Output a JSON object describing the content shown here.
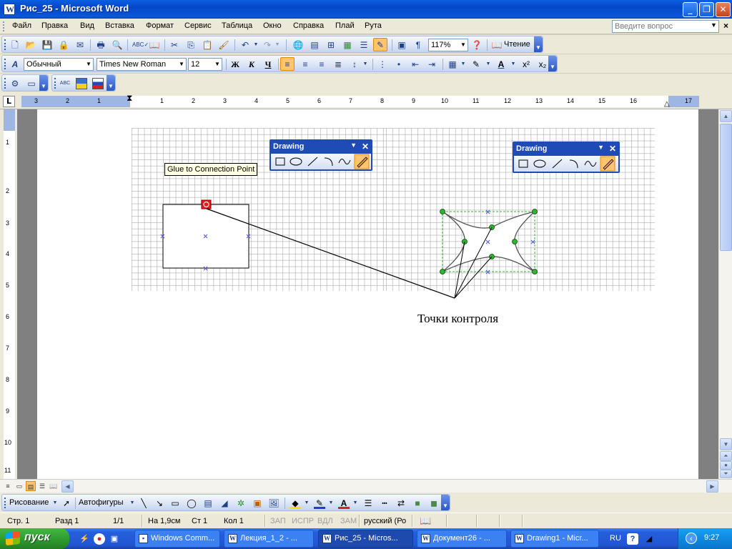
{
  "window": {
    "title": "Рис_25 - Microsoft Word"
  },
  "menu": {
    "items": [
      "Файл",
      "Правка",
      "Вид",
      "Вставка",
      "Формат",
      "Сервис",
      "Таблица",
      "Окно",
      "Справка",
      "Плай",
      "Рута"
    ],
    "help_placeholder": "Введите вопрос"
  },
  "standard_toolbar": {
    "zoom": "117%",
    "reading_label": "Чтение"
  },
  "formatting_toolbar": {
    "style": "Обычный",
    "font": "Times New Roman",
    "size": "12",
    "bold": "Ж",
    "italic": "К",
    "underline": "Ч"
  },
  "ruler": {
    "left_labels": [
      "3",
      "2",
      "1"
    ],
    "right_labels": [
      "1",
      "2",
      "3",
      "4",
      "5",
      "6",
      "7",
      "8",
      "9",
      "10",
      "11",
      "12",
      "13",
      "14",
      "15",
      "16",
      "17"
    ],
    "vertical_labels": [
      "1",
      "2",
      "3",
      "4",
      "5",
      "6",
      "7",
      "8",
      "9",
      "10",
      "11"
    ],
    "corner": "L"
  },
  "figure": {
    "drawing_toolbar_title": "Drawing",
    "tooltip": "Glue to Connection Point",
    "caption": "Точки контроля"
  },
  "drawing_bar": {
    "draw_label": "Рисование",
    "autoshapes_label": "Автофигуры"
  },
  "status": {
    "page": "Стр. 1",
    "section": "Разд 1",
    "pages": "1/1",
    "at": "На 1,9см",
    "line": "Ст 1",
    "col": "Кол 1",
    "rec": "ЗАП",
    "trk": "ИСПР",
    "ext": "ВДЛ",
    "ovr": "ЗАМ",
    "lang": "русский (Ро"
  },
  "taskbar": {
    "start": "пуск",
    "tasks": [
      "Windows Comm...",
      "Лекция_1_2 - ...",
      "Рис_25 - Micros...",
      "Документ26 - ...",
      "Drawing1 - Micr..."
    ],
    "lang": "RU",
    "time": "9:27"
  },
  "colors": {
    "title_blue": "#0447c8",
    "taskbar_blue": "#245edb",
    "start_green": "#2f9e30",
    "active_button": "#ffc56e"
  }
}
